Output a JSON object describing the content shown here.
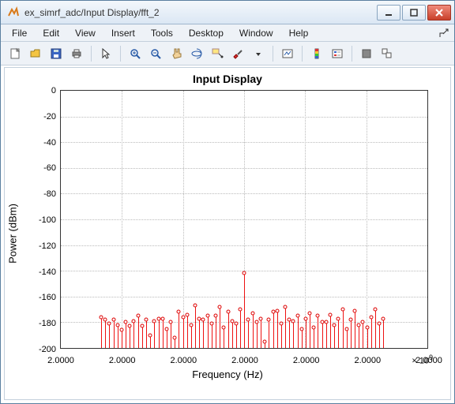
{
  "window": {
    "title": "ex_simrf_adc/Input Display/fft_2"
  },
  "menus": [
    "File",
    "Edit",
    "View",
    "Insert",
    "Tools",
    "Desktop",
    "Window",
    "Help"
  ],
  "chart_data": {
    "type": "stem",
    "title": "Input Display",
    "xlabel": "Frequency (Hz)",
    "ylabel": "Power (dBm)",
    "x_multiplier_label": "× 10",
    "x_multiplier_exp": "9",
    "xlim": [
      2.0,
      2.0
    ],
    "ylim": [
      -200,
      0
    ],
    "xticks_labels": [
      "2.0000",
      "2.0000",
      "2.0000",
      "2.0000",
      "2.0000",
      "2.0000",
      "2.0000"
    ],
    "yticks": [
      0,
      -20,
      -40,
      -60,
      -80,
      -100,
      -120,
      -140,
      -160,
      -180,
      -200
    ],
    "x_index": [
      0,
      1,
      2,
      3,
      4,
      5,
      6,
      7,
      8,
      9,
      10,
      11,
      12,
      13,
      14,
      15,
      16,
      17,
      18,
      19,
      20,
      21,
      22,
      23,
      24,
      25,
      26,
      27,
      28,
      29,
      30,
      31,
      32,
      33,
      34,
      35,
      36,
      37,
      38,
      39,
      40,
      41,
      42,
      43,
      44,
      45,
      46,
      47,
      48,
      49,
      50,
      51,
      52,
      53,
      54,
      55,
      56,
      57,
      58,
      59,
      60,
      61,
      62,
      63,
      64,
      65,
      66,
      67,
      68,
      69
    ],
    "x_range_frac": [
      0.11,
      0.88
    ],
    "y": [
      -176,
      -178,
      -181,
      -178,
      -182,
      -186,
      -180,
      -183,
      -179,
      -175,
      -183,
      -178,
      -190,
      -179,
      -177,
      -177,
      -185,
      -180,
      -192,
      -172,
      -176,
      -174,
      -182,
      -167,
      -177,
      -178,
      -175,
      -181,
      -175,
      -168,
      -184,
      -172,
      -179,
      -181,
      -170,
      -142,
      -178,
      -173,
      -180,
      -177,
      -195,
      -178,
      -172,
      -171,
      -181,
      -168,
      -178,
      -179,
      -175,
      -185,
      -177,
      -173,
      -184,
      -175,
      -180,
      -180,
      -174,
      -182,
      -177,
      -170,
      -185,
      -178,
      -171,
      -182,
      -180,
      -184,
      -176,
      -170,
      -181,
      -177
    ]
  }
}
